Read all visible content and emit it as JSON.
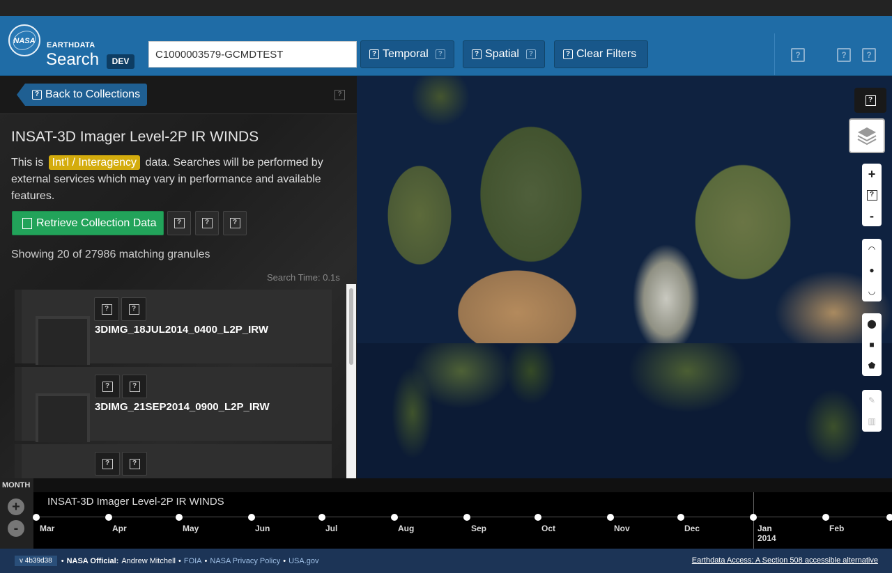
{
  "header": {
    "brand_small": "EARTHDATA",
    "brand_big": "Search",
    "env_badge": "DEV",
    "logo_text": "NASA",
    "search_value": "C1000003579-GCMDTEST",
    "temporal_label": "Temporal",
    "spatial_label": "Spatial",
    "clear_label": "Clear Filters"
  },
  "panel": {
    "back_label": "Back to Collections",
    "title": "INSAT-3D Imager Level-2P IR WINDS",
    "desc_before": "This is ",
    "badge": "Int'l / Interagency",
    "desc_after": " data. Searches will be performed by external services which may vary in performance and available features.",
    "retrieve_label": "Retrieve Collection Data",
    "showing": "Showing 20 of 27986 matching granules",
    "search_time": "Search Time: 0.1s"
  },
  "granules": [
    {
      "name": "3DIMG_18JUL2014_0400_L2P_IRW"
    },
    {
      "name": "3DIMG_21SEP2014_0900_L2P_IRW"
    },
    {
      "name": ""
    }
  ],
  "timeline": {
    "zoom_level": "MONTH",
    "collection": "INSAT-3D Imager Level-2P IR WINDS",
    "months": [
      "Mar",
      "Apr",
      "May",
      "Jun",
      "Jul",
      "Aug",
      "Sep",
      "Oct",
      "Nov",
      "Dec",
      "Jan",
      "Feb"
    ],
    "year_label": "2014"
  },
  "footer": {
    "version": "v 4b39d38",
    "official_label": "NASA Official:",
    "official_name": "Andrew Mitchell",
    "foia": "FOIA",
    "privacy": "NASA Privacy Policy",
    "usa": "USA.gov",
    "access": "Earthdata Access: A Section 508 accessible alternative"
  },
  "icons": {
    "help": "question-icon",
    "zoom_in": "+",
    "zoom_out": "-"
  },
  "colors": {
    "header_blue": "#1f6ca6",
    "intl_badge": "#d4ac0d",
    "retrieve_green": "#22a35a",
    "footer": "#1c3456"
  }
}
